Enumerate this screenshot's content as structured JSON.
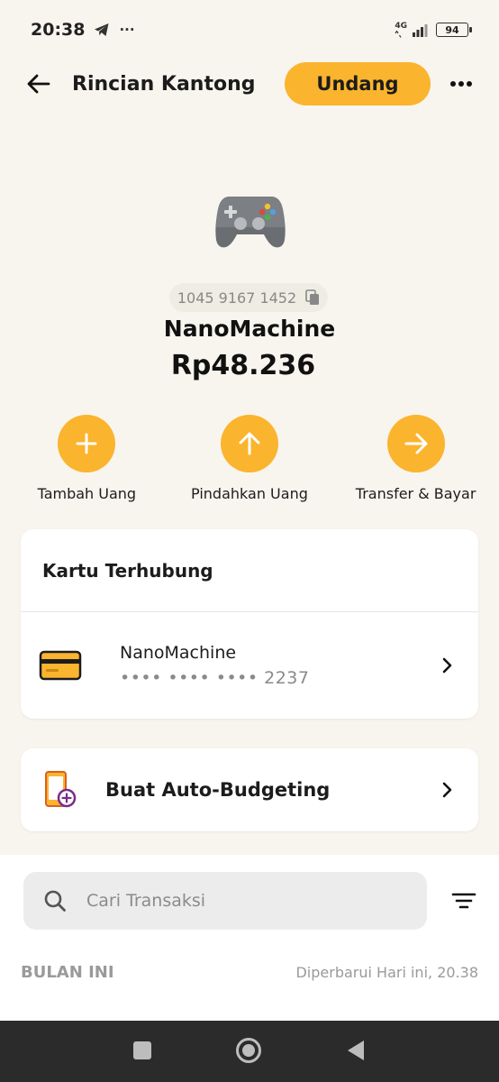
{
  "status_bar": {
    "time": "20:38",
    "more": "···",
    "network": "4G",
    "battery": "94"
  },
  "header": {
    "title": "Rincian Kantong",
    "invite_label": "Undang"
  },
  "pocket": {
    "icon": "gamepad-icon",
    "account_number": "1045 9167 1452",
    "name": "NanoMachine",
    "balance": "Rp48.236"
  },
  "actions": [
    {
      "label": "Tambah Uang",
      "icon": "plus-icon"
    },
    {
      "label": "Pindahkan Uang",
      "icon": "arrow-up-icon"
    },
    {
      "label": "Transfer & Bayar",
      "icon": "arrow-right-icon"
    }
  ],
  "linked_cards": {
    "title": "Kartu Terhubung",
    "card_name": "NanoMachine",
    "card_number": "•••• •••• •••• 2237"
  },
  "auto_budget": {
    "label": "Buat Auto-Budgeting"
  },
  "transactions": {
    "search_placeholder": "Cari Transaksi",
    "period": "BULAN INI",
    "updated": "Diperbarui Hari ini, 20.38"
  },
  "colors": {
    "accent": "#fbb42e",
    "background": "#f8f5ee",
    "nav_bar": "#2b2b2b"
  }
}
